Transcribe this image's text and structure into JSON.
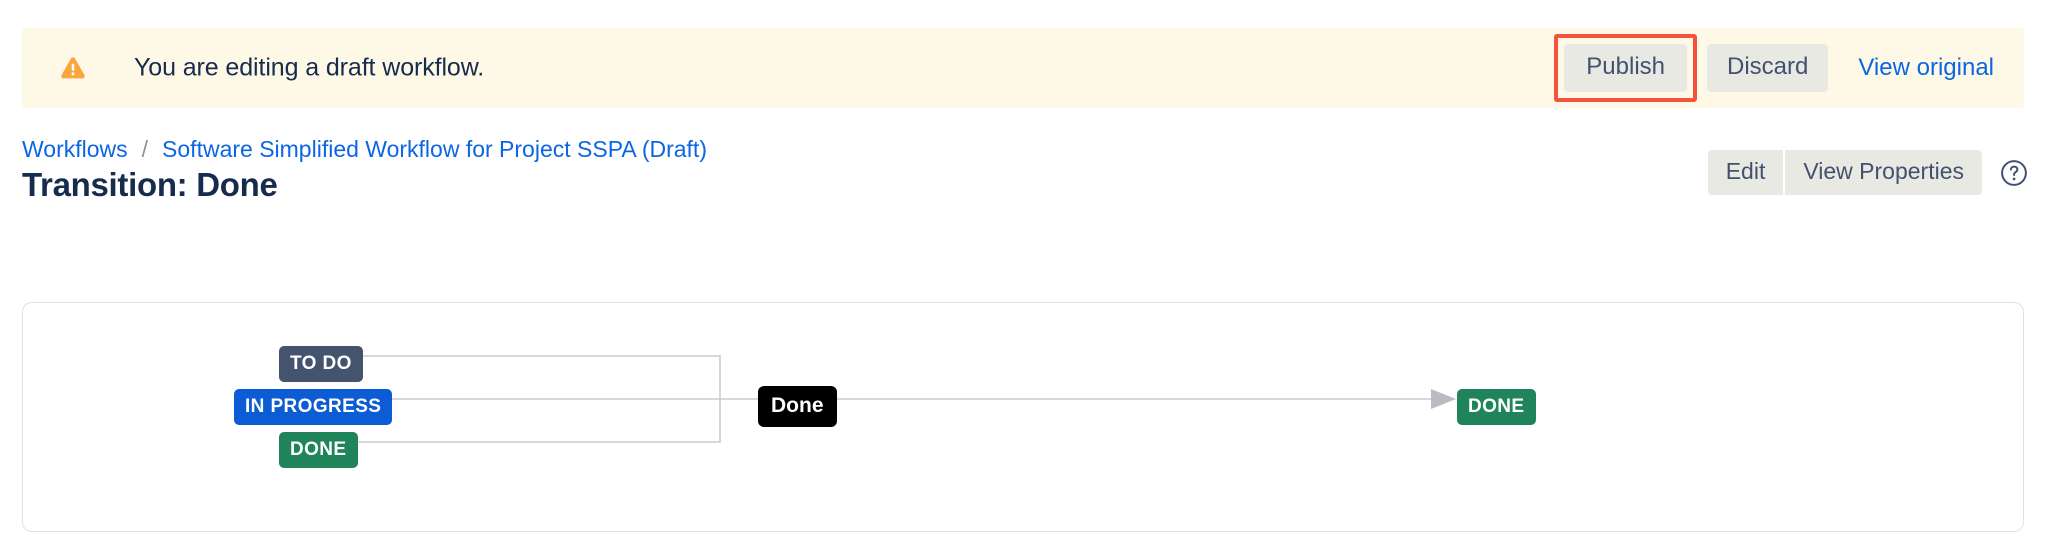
{
  "banner": {
    "icon": "warning-triangle-icon",
    "message": "You are editing a draft workflow.",
    "publish_label": "Publish",
    "discard_label": "Discard",
    "view_original_label": "View original",
    "background_color": "#FEF9E7",
    "icon_color": "#FAA53D",
    "highlight_color": "#F5513C"
  },
  "breadcrumb": {
    "root_label": "Workflows",
    "separator": "/",
    "current_label": "Software Simplified Workflow for Project SSPA (Draft)",
    "link_color": "#0C66E4"
  },
  "page": {
    "title": "Transition: Done"
  },
  "header_actions": {
    "edit_label": "Edit",
    "view_properties_label": "View Properties",
    "help_icon": "question-circle-icon"
  },
  "diagram": {
    "source_statuses": [
      {
        "label": "TO DO",
        "color": "#44546F"
      },
      {
        "label": "IN PROGRESS",
        "color": "#0B5CD5"
      },
      {
        "label": "DONE",
        "color": "#1F845A"
      }
    ],
    "transition_label": "Done",
    "target_status": {
      "label": "DONE",
      "color": "#1F845A"
    },
    "connector_color": "#C9CCD1",
    "arrow_color": "#B8BCC2"
  }
}
